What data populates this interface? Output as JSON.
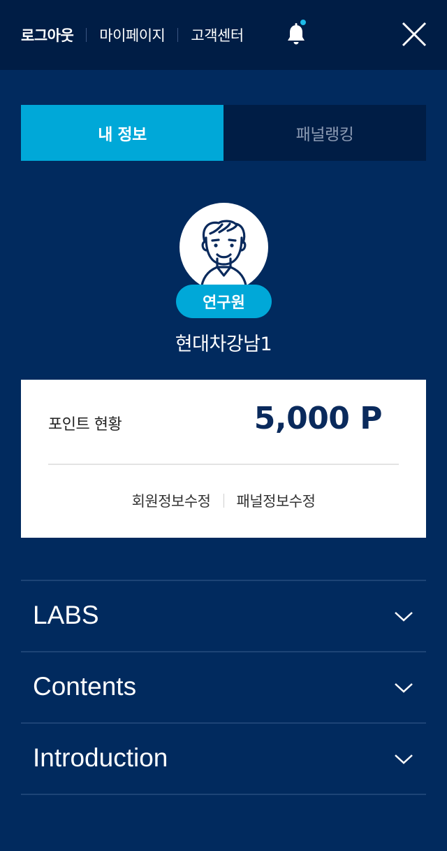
{
  "header": {
    "nav": [
      {
        "label": "로그아웃"
      },
      {
        "label": "마이페이지"
      },
      {
        "label": "고객센터"
      }
    ],
    "bell_icon": "bell-icon",
    "close_icon": "close-icon",
    "notification_dot_color": "#1dbbe8"
  },
  "tabs": [
    {
      "label": "내 정보",
      "active": true
    },
    {
      "label": "패널랭킹",
      "active": false
    }
  ],
  "profile": {
    "avatar_icon": "avatar-icon",
    "role": "연구원",
    "name": "현대차강남1"
  },
  "points": {
    "label": "포인트 현황",
    "value": "5,000 P",
    "links": [
      {
        "label": "회원정보수정"
      },
      {
        "label": "패널정보수정"
      }
    ]
  },
  "menu": [
    {
      "label": "LABS",
      "icon": "chevron-down-icon"
    },
    {
      "label": "Contents",
      "icon": "chevron-down-icon"
    },
    {
      "label": "Introduction",
      "icon": "chevron-down-icon"
    }
  ],
  "colors": {
    "background": "#012a5e",
    "header": "#001d45",
    "accent": "#00a8d8",
    "point_text": "#0a2a5c"
  }
}
